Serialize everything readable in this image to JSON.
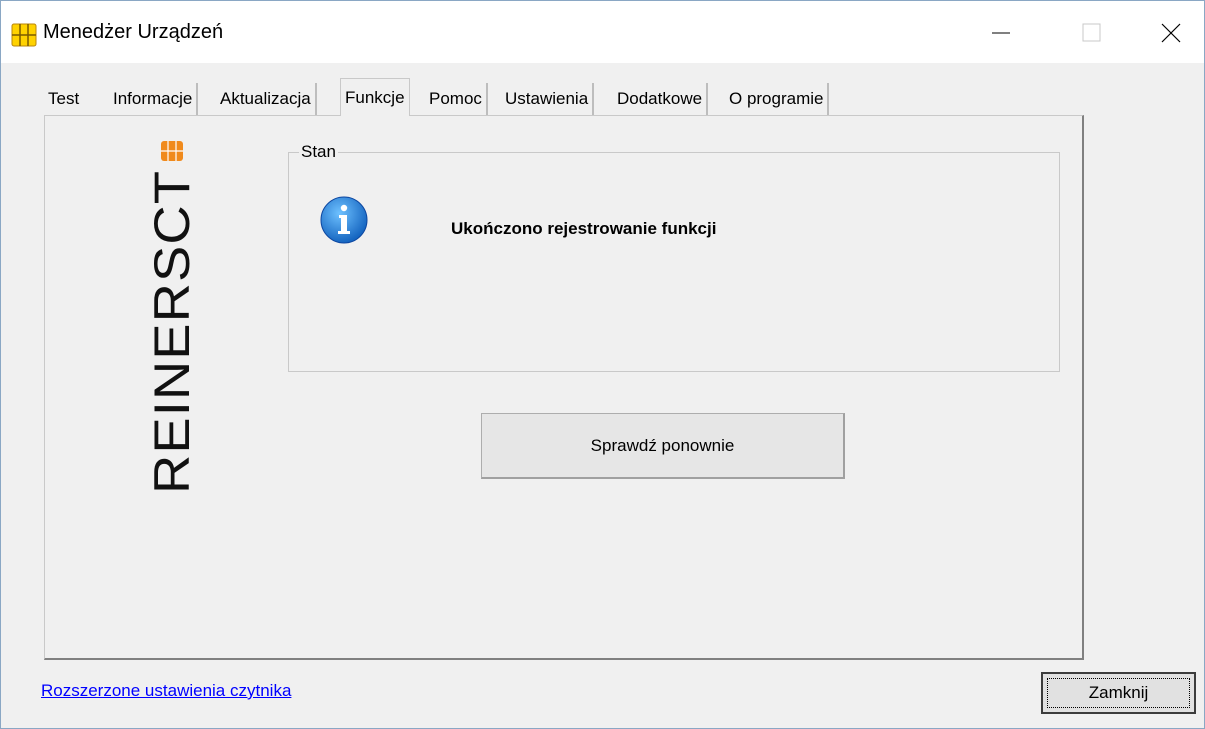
{
  "window": {
    "title": "Menedżer Urządzeń",
    "controls": {
      "minimize": "minimize-icon",
      "maximize": "maximize-icon",
      "close": "close-icon"
    }
  },
  "tabs": [
    {
      "label": "Test",
      "active": false
    },
    {
      "label": "Informacje",
      "active": false
    },
    {
      "label": "Aktualizacja",
      "active": false
    },
    {
      "label": "Funkcje",
      "active": true
    },
    {
      "label": "Pomoc",
      "active": false
    },
    {
      "label": "Ustawienia",
      "active": false
    },
    {
      "label": "Dodatkowe",
      "active": false
    },
    {
      "label": "O programie",
      "active": false
    }
  ],
  "panel": {
    "logo_text": "REINERSCT",
    "group": {
      "legend": "Stan",
      "icon": "info-icon",
      "message": "Ukończono rejestrowanie funkcji"
    },
    "recheck_button": "Sprawdź ponownie"
  },
  "footer": {
    "advanced_link": "Rozszerzone ustawienia czytnika",
    "close_button": "Zamknij"
  },
  "colors": {
    "link": "#0000ff",
    "info_icon": "#1e88e5",
    "logo_chip": "#f08a1c",
    "app_icon": "#ffd200"
  }
}
